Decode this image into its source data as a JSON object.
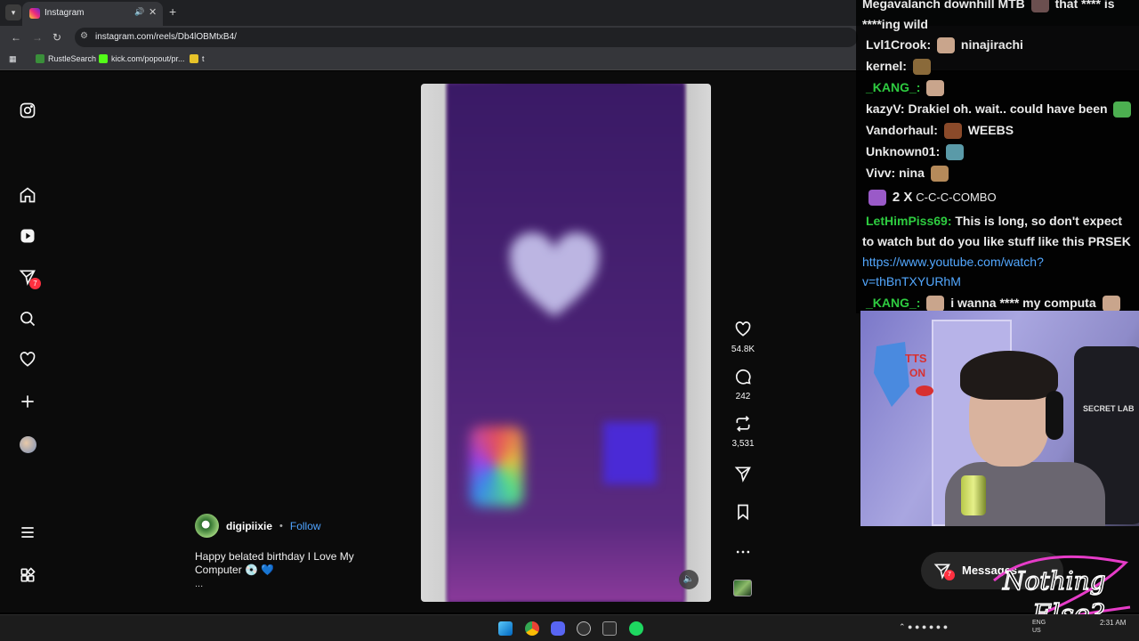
{
  "browser": {
    "tab_title": "Instagram",
    "url": "instagram.com/reels/Db4lOBMtxB4/",
    "bookmarks": [
      "RustleSearch",
      "kick.com/popout/pr...",
      "t"
    ]
  },
  "sidebar": {
    "items": [
      "instagram-logo",
      "home",
      "reels",
      "messages",
      "search",
      "notifications",
      "create",
      "profile",
      "more",
      "also-from-meta"
    ],
    "messages_badge": "7"
  },
  "reel": {
    "author": "digipiixie",
    "separator": "•",
    "follow_label": "Follow",
    "caption": "Happy belated birthday I Love My Computer 💿 💙",
    "caption_more": "...",
    "likes": "54.8K",
    "comments": "242",
    "reposts": "3,531"
  },
  "messages_button": {
    "label": "Messages",
    "badge": "7"
  },
  "chat": {
    "lines": [
      {
        "user": "",
        "text": "Megavalanch downhill MTB",
        "after": "that **** is"
      },
      {
        "user": "",
        "text": "****ing wild",
        "after": ""
      },
      {
        "user": "Lvl1Crook:",
        "text": "",
        "after": "ninajirachi"
      },
      {
        "user": "kernel:",
        "text": "",
        "after": ""
      },
      {
        "user": "_KANG_:",
        "text": "",
        "after": ""
      },
      {
        "user": "kazyV:",
        "text": "Drakiel oh. wait.. could have been",
        "after": ""
      },
      {
        "user": "Vandorhaul:",
        "text": "",
        "after": "WEEBS"
      },
      {
        "user": "Unknown01:",
        "text": "",
        "after": ""
      },
      {
        "user": "Vivv:",
        "text": "nina",
        "after": ""
      },
      {
        "user": "",
        "text": "2 X",
        "after": "C-C-C-COMBO"
      },
      {
        "user": "LetHimPiss69:",
        "text": "This is long, so don't expect",
        "after": ""
      },
      {
        "user": "",
        "text": "to watch but do you like stuff like this PRSEK",
        "after": ""
      },
      {
        "user": "_KANG_:",
        "text": "",
        "after": "i wanna **** my computa"
      }
    ],
    "link_line1": "https://www.youtube.com/watch?",
    "link_line2": "v=thBnTXYURhM",
    "colors": {
      "user_green": "#2ecc40",
      "user_white": "#eaeaea",
      "link": "#53a8ff"
    }
  },
  "webcam": {
    "sign_text": "TTS ON",
    "chair_brand": "SECRET LAB"
  },
  "overlay_logo": "Nothing Else?",
  "taskbar": {
    "lang_top": "ENG",
    "lang_bottom": "US",
    "time": "2:31 AM"
  },
  "theme": {
    "accent_red": "#ff3040",
    "link_blue": "#4fa3ff"
  }
}
